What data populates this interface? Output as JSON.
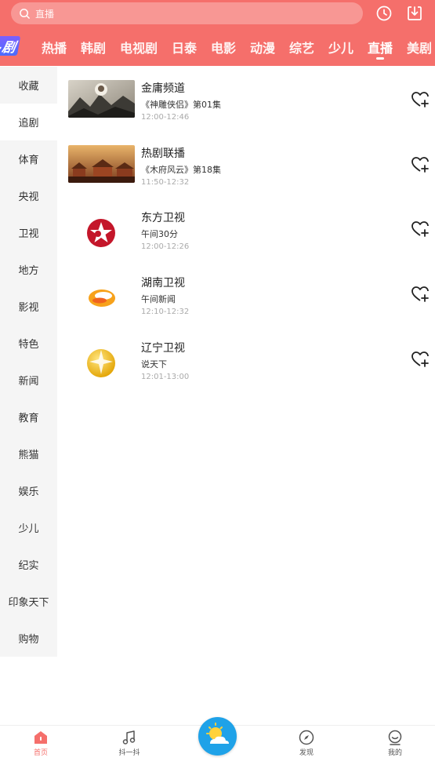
{
  "header": {
    "search_placeholder": "直播",
    "icons": [
      "search-icon",
      "history-icon",
      "download-icon"
    ],
    "promo_label": "-剧",
    "tabs": [
      {
        "label": "热播"
      },
      {
        "label": "韩剧"
      },
      {
        "label": "电视剧"
      },
      {
        "label": "日泰"
      },
      {
        "label": "电影"
      },
      {
        "label": "动漫"
      },
      {
        "label": "综艺"
      },
      {
        "label": "少儿"
      },
      {
        "label": "直播",
        "active": true
      },
      {
        "label": "美剧"
      }
    ]
  },
  "sidebar": {
    "items": [
      "收藏",
      "追剧",
      "体育",
      "央视",
      "卫视",
      "地方",
      "影视",
      "特色",
      "新闻",
      "教育",
      "熊猫",
      "娱乐",
      "少儿",
      "纪实",
      "印象天下",
      "购物"
    ],
    "active": "追剧"
  },
  "channels": [
    {
      "name": "金庸频道",
      "program": "《神雕侠侣》第01集",
      "time": "12:00-12:46"
    },
    {
      "name": "热剧联播",
      "program": "《木府风云》第18集",
      "time": "11:50-12:32"
    },
    {
      "name": "东方卫视",
      "program": "午间30分",
      "time": "12:00-12:26"
    },
    {
      "name": "湖南卫视",
      "program": "午间新闻",
      "time": "12:10-12:32"
    },
    {
      "name": "辽宁卫视",
      "program": "说天下",
      "time": "12:01-13:00"
    }
  ],
  "bottom_nav": {
    "items": [
      {
        "label": "首页",
        "icon": "home-icon",
        "active": true
      },
      {
        "label": "抖一抖",
        "icon": "music-note-icon"
      },
      {
        "label": "发现",
        "icon": "compass-icon"
      },
      {
        "label": "我的",
        "icon": "profile-icon"
      }
    ],
    "center_icon": "weather-sun-cloud-icon"
  },
  "colors": {
    "accent": "#f56f6b",
    "sidebar_bg": "#f5f5f5",
    "center_button": "#1fa2e8"
  }
}
